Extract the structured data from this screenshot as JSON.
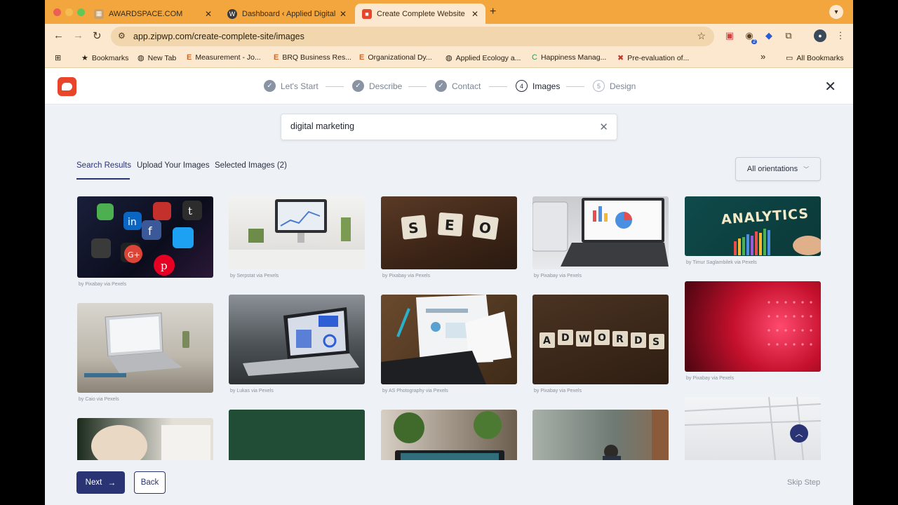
{
  "browser": {
    "tabs": [
      {
        "title": "AWARDSPACE.COM",
        "active": false
      },
      {
        "title": "Dashboard ‹ Applied Digital E",
        "active": false
      },
      {
        "title": "Create Complete Website",
        "active": true
      }
    ],
    "new_tab_symbol": "+",
    "url": "app.zipwp.com/create-complete-site/images",
    "extension_badge": "2",
    "bookmarks": [
      {
        "label": "Bookmarks",
        "icon": "star-icon"
      },
      {
        "label": "New Tab",
        "icon": "globe-icon"
      },
      {
        "label": "Measurement - Jo...",
        "icon": "e-icon"
      },
      {
        "label": "BRQ Business Res...",
        "icon": "e-icon"
      },
      {
        "label": "Organizational Dy...",
        "icon": "e-icon"
      },
      {
        "label": "Applied Ecology a...",
        "icon": "globe-icon"
      },
      {
        "label": "Happiness Manag...",
        "icon": "c-icon"
      },
      {
        "label": "Pre-evaluation of...",
        "icon": "x-icon"
      }
    ],
    "bookmarks_overflow": "»",
    "all_bookmarks": "All Bookmarks"
  },
  "wizard": {
    "steps": [
      {
        "number": "✓",
        "label": "Let's Start",
        "state": "done"
      },
      {
        "number": "✓",
        "label": "Describe",
        "state": "done"
      },
      {
        "number": "✓",
        "label": "Contact",
        "state": "done"
      },
      {
        "number": "4",
        "label": "Images",
        "state": "current"
      },
      {
        "number": "5",
        "label": "Design",
        "state": "todo"
      }
    ]
  },
  "search": {
    "value": "digital marketing"
  },
  "subtabs": [
    "Search Results",
    "Upload Your Images",
    "Selected Images (2)"
  ],
  "orientation": "All orientations",
  "images": [
    {
      "credit": "by Pixabay via Pexels",
      "icon": "social-media-apps-image"
    },
    {
      "credit": "by Serpstat via Pexels",
      "icon": "desk-computer-image"
    },
    {
      "credit": "by Pixabay via Pexels",
      "icon": "seo-tiles-image",
      "text": "S E O"
    },
    {
      "credit": "by Pixabay via Pexels",
      "icon": "laptop-charts-image"
    },
    {
      "credit": "by Timur Saglambilek via Pexels",
      "icon": "analytics-board-image",
      "text": "ANALYTICS"
    },
    {
      "credit": "by Caio via Pexels",
      "icon": "laptop-google-image"
    },
    {
      "credit": "by Lukas via Pexels",
      "icon": "laptop-dashboard-image"
    },
    {
      "credit": "by AS Photography via Pexels",
      "icon": "reports-keyboard-image"
    },
    {
      "credit": "by Pixabay via Pexels",
      "icon": "adwords-tiles-image",
      "text": "A D W O R D S"
    },
    {
      "credit": "by Pixabay via Pexels",
      "icon": "red-lights-image"
    },
    {
      "credit": "",
      "icon": "people-working-image"
    },
    {
      "credit": "",
      "icon": "green-wall-image"
    },
    {
      "credit": "",
      "icon": "plants-monitor-image"
    },
    {
      "credit": "",
      "icon": "office-meeting-image"
    },
    {
      "credit": "",
      "icon": "white-interior-image"
    }
  ],
  "footer": {
    "next": "Next",
    "back": "Back",
    "skip": "Skip Step"
  }
}
